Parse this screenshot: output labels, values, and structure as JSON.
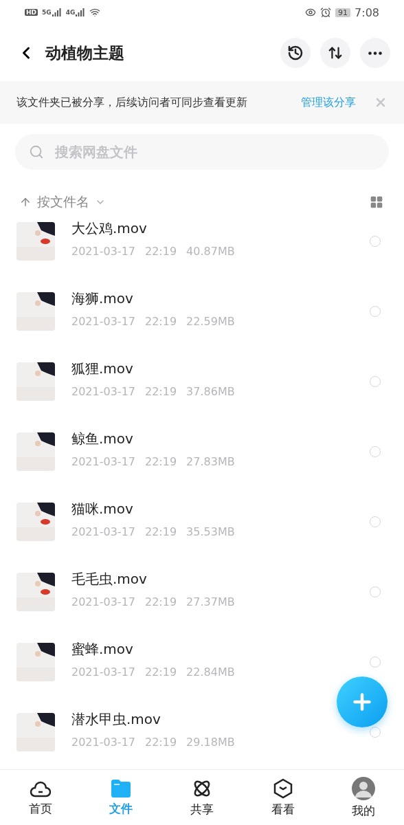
{
  "status_bar": {
    "hd_label": "HD",
    "network_labels": [
      "5G",
      "4G"
    ],
    "battery": "91",
    "time": "7:08"
  },
  "header": {
    "title": "动植物主题"
  },
  "share_banner": {
    "message": "该文件夹已被分享，后续访问者可同步查看更新",
    "action": "管理该分享"
  },
  "search": {
    "placeholder": "搜索网盘文件"
  },
  "sort": {
    "label": "按文件名"
  },
  "files": [
    {
      "name": "大公鸡.mov",
      "date": "2021-03-17",
      "time": "22:19",
      "size": "40.87MB",
      "selected": false
    },
    {
      "name": "海狮.mov",
      "date": "2021-03-17",
      "time": "22:19",
      "size": "22.59MB",
      "selected": false
    },
    {
      "name": "狐狸.mov",
      "date": "2021-03-17",
      "time": "22:19",
      "size": "37.86MB",
      "selected": false
    },
    {
      "name": "鲸鱼.mov",
      "date": "2021-03-17",
      "time": "22:19",
      "size": "27.83MB",
      "selected": false
    },
    {
      "name": "猫咪.mov",
      "date": "2021-03-17",
      "time": "22:19",
      "size": "35.53MB",
      "selected": false
    },
    {
      "name": "毛毛虫.mov",
      "date": "2021-03-17",
      "time": "22:19",
      "size": "27.37MB",
      "selected": false
    },
    {
      "name": "蜜蜂.mov",
      "date": "2021-03-17",
      "time": "22:19",
      "size": "22.84MB",
      "selected": false
    },
    {
      "name": "潜水甲虫.mov",
      "date": "2021-03-17",
      "time": "22:19",
      "size": "29.18MB",
      "selected": false
    }
  ],
  "tabs": [
    {
      "label": "首页",
      "kind": "cloud",
      "selected": false
    },
    {
      "label": "文件",
      "kind": "folder",
      "selected": true
    },
    {
      "label": "共享",
      "kind": "orbit",
      "selected": false
    },
    {
      "label": "看看",
      "kind": "cube",
      "selected": false
    },
    {
      "label": "我的",
      "kind": "avatar",
      "selected": false
    }
  ]
}
